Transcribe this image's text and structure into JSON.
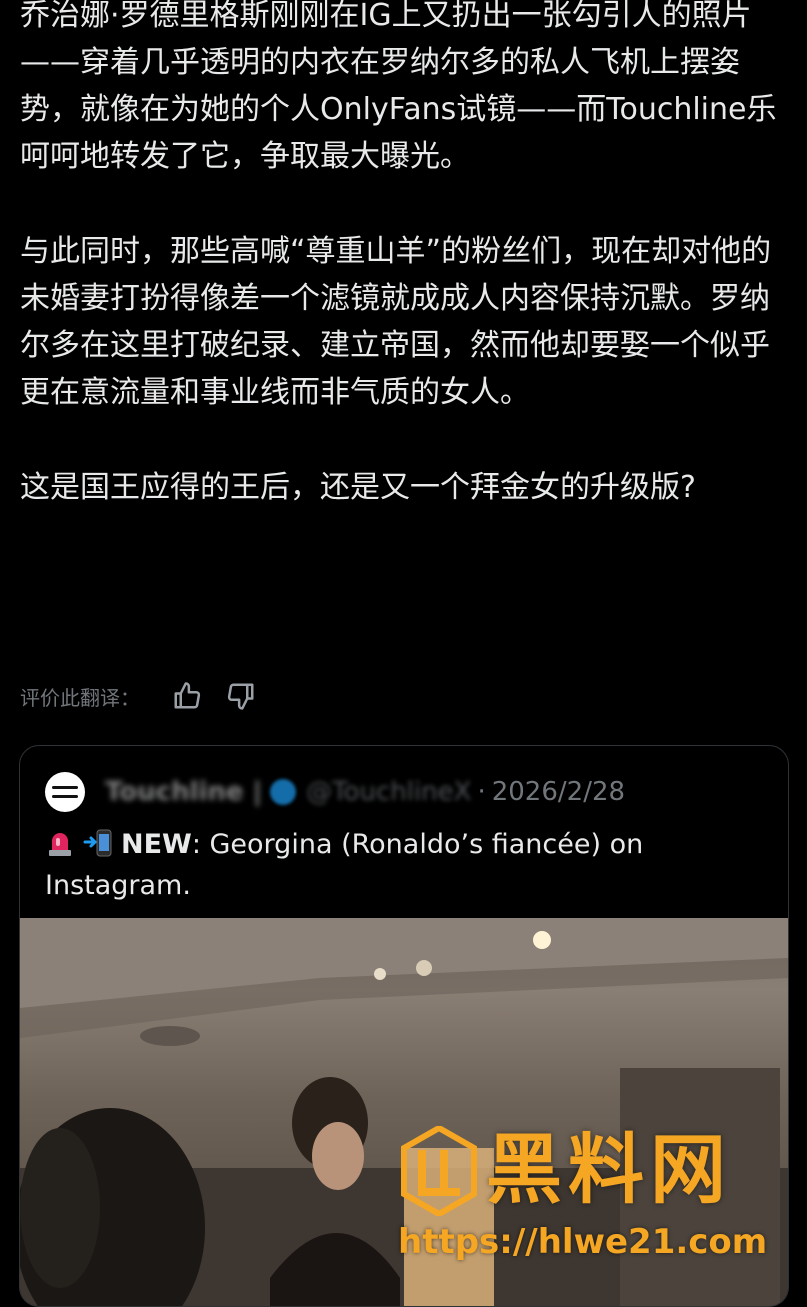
{
  "post": {
    "paragraphs": [
      "乔治娜·罗德里格斯刚刚在IG上又扔出一张勾引人的照片——穿着几乎透明的内衣在罗纳尔多的私人飞机上摆姿势，就像在为她的个人OnlyFans试镜——而Touchline乐呵呵地转发了它，争取最大曝光。",
      "与此同时，那些高喊“尊重山羊”的粉丝们，现在却对他的未婚妻打扮得像差一个滤镜就成成人内容保持沉默。罗纳尔多在这里打破纪录、建立帝国，然而他却要娶一个似乎更在意流量和事业线而非气质的女人。",
      "这是国王应得的王后，还是又一个拜金女的升级版?"
    ]
  },
  "rating": {
    "label": "评价此翻译：",
    "thumbs_up_icon": "thumbs-up-icon",
    "thumbs_down_icon": "thumbs-down-icon"
  },
  "quote": {
    "avatar_icon": "touchline-logo",
    "name": "Touchline | ",
    "handle": "@TouchlineX",
    "dot": "·",
    "date": "2026/2/28",
    "emoji_1": "rotating-light-icon",
    "emoji_2": "phone-arrow-icon",
    "new_label": "NEW",
    "text": ": Georgina (Ronaldo’s fiancée) on Instagram."
  },
  "watermark": {
    "main": "黑料网",
    "url": "https://hlwe21.com"
  },
  "colors": {
    "background": "#000000",
    "text": "#e7e9ea",
    "muted": "#71767b",
    "border": "#2f3336",
    "watermark": "#f5a623"
  }
}
